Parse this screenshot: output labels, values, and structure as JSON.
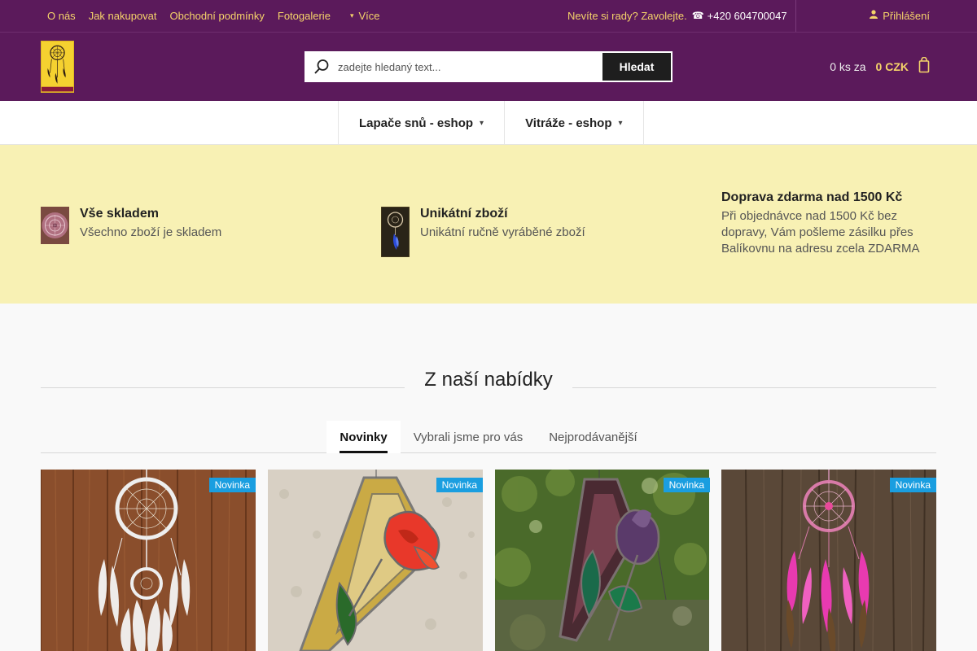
{
  "topbar": {
    "links": [
      "O nás",
      "Jak nakupovat",
      "Obchodní podmínky",
      "Fotogalerie"
    ],
    "more_label": "Více",
    "help_text": "Nevíte si rady? Zavolejte.",
    "phone": "+420 604700047",
    "login_label": "Přihlášení"
  },
  "header": {
    "search_placeholder": "zadejte hledaný text...",
    "search_button": "Hledat",
    "cart_qty": "0 ks za",
    "cart_price": "0 CZK"
  },
  "categories": [
    "Lapače snů - eshop",
    "Vitráže - eshop"
  ],
  "benefits": [
    {
      "title": "Vše skladem",
      "text": "Všechno zboží je skladem"
    },
    {
      "title": "Unikátní zboží",
      "text": "Unikátní ručně vyráběné zboží"
    },
    {
      "title": "Doprava zdarma nad 1500 Kč",
      "text": "Při objednávce nad 1500 Kč bez dopravy, Vám pošleme zásilku přes Balíkovnu na adresu zcela ZDARMA"
    }
  ],
  "offer": {
    "title": "Z naší nabídky",
    "tabs": [
      "Novinky",
      "Vybrali jsme pro vás",
      "Nejprodávanější"
    ]
  },
  "products": [
    {
      "badge": "Novinka"
    },
    {
      "badge": "Novinka"
    },
    {
      "badge": "Novinka"
    },
    {
      "badge": "Novinka"
    }
  ],
  "colors": {
    "brand_purple": "#5b1a5b",
    "accent_yellow": "#f5d36a",
    "benefits_bg": "#f8f1b4",
    "badge_blue": "#1a9ee0"
  }
}
